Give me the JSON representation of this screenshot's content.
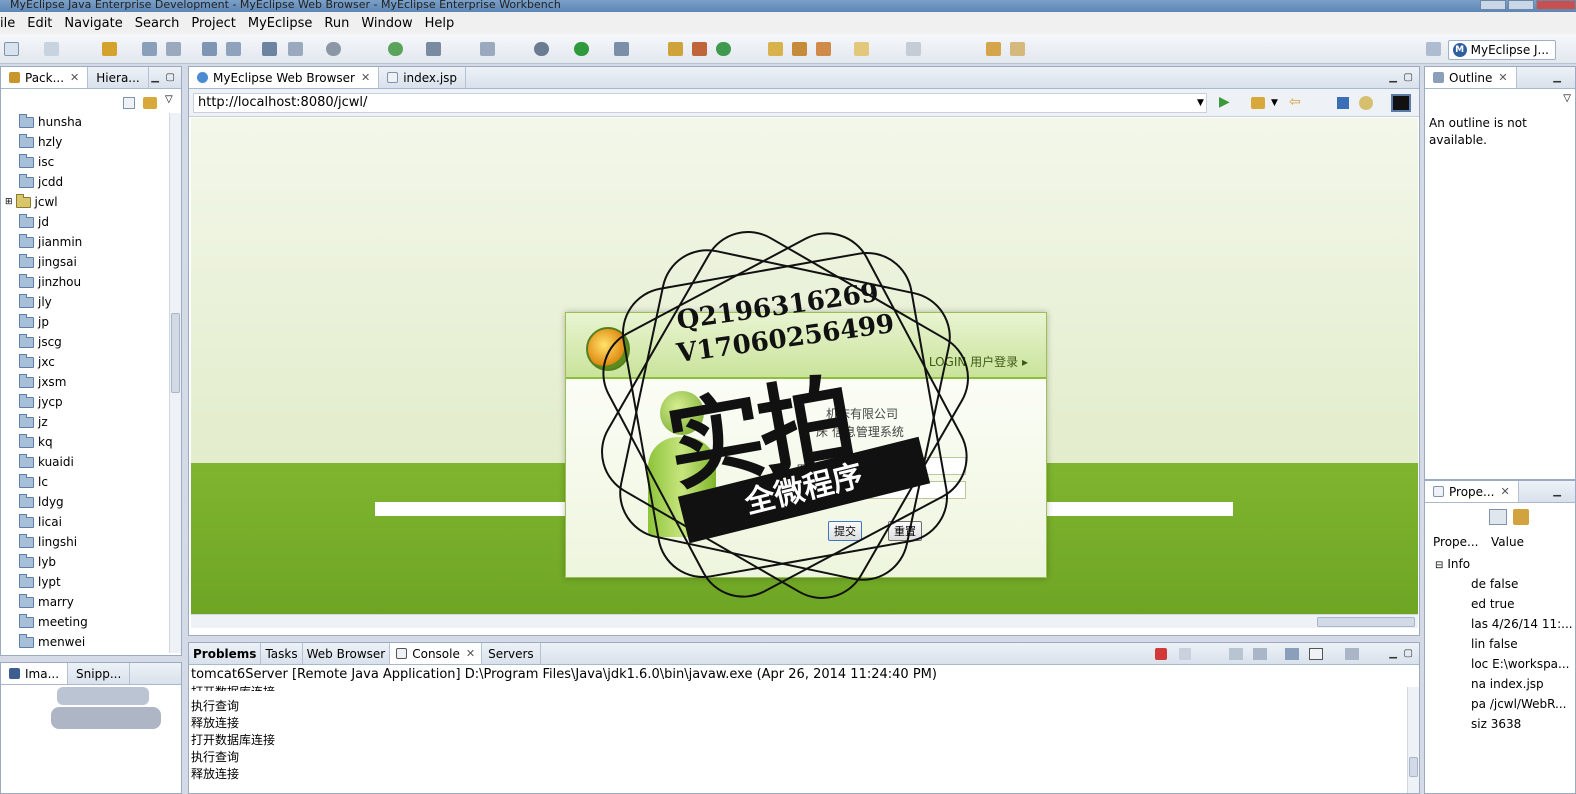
{
  "window": {
    "title": "MyEclipse Java Enterprise Development - MyEclipse Web Browser - MyEclipse Enterprise Workbench"
  },
  "menu": [
    "ile",
    "Edit",
    "Navigate",
    "Search",
    "Project",
    "MyEclipse",
    "Run",
    "Window",
    "Help"
  ],
  "perspective": {
    "label": "MyEclipse J...",
    "icon": "M"
  },
  "left_panel": {
    "tabs": [
      {
        "label": "Pack...",
        "close": "✕"
      },
      {
        "label": "Hiera..."
      }
    ],
    "items": [
      "hunsha",
      "hzly",
      "isc",
      "jcdd",
      "jcwl",
      "jd",
      "jianmin",
      "jingsai",
      "jinzhou",
      "jly",
      "jp",
      "jscg",
      "jxc",
      "jxsm",
      "jycp",
      "jz",
      "kq",
      "kuaidi",
      "lc",
      "ldyg",
      "licai",
      "lingshi",
      "lyb",
      "lypt",
      "marry",
      "meeting",
      "menwei"
    ]
  },
  "image_panel": {
    "tabs": [
      {
        "label": "Ima..."
      },
      {
        "label": "Snipp..."
      }
    ]
  },
  "editor": {
    "tabs": [
      {
        "label": "MyEclipse Web Browser",
        "close": "✕"
      },
      {
        "label": "index.jsp"
      }
    ],
    "url": "http://localhost:8080/jcwl/"
  },
  "login_page": {
    "title": "LOGIN 用户登录 ▸",
    "company_line1": "机床有限公司",
    "company_line2": "床 信息管理系统",
    "user_label": "用户:",
    "submit_label": "提交",
    "reset_label": "重置"
  },
  "watermark": {
    "qq": "Q2196316269",
    "wechat": "V17060256499",
    "big_text": "实拍",
    "ribbon": "全微程序",
    "star": "★"
  },
  "outline": {
    "tab": "Outline",
    "close": "✕",
    "message": "An outline is not available."
  },
  "properties": {
    "tab": "Prope...",
    "close": "✕",
    "col_property": "Prope...",
    "col_value": "Value",
    "group": "Info",
    "group_toggle": "⊟",
    "rows": [
      {
        "key": "de",
        "value": "false"
      },
      {
        "key": "ed",
        "value": "true"
      },
      {
        "key": "las",
        "value": "4/26/14 11:..."
      },
      {
        "key": "lin",
        "value": "false"
      },
      {
        "key": "loc",
        "value": "E:\\workspa..."
      },
      {
        "key": "na",
        "value": "index.jsp"
      },
      {
        "key": "pa",
        "value": "/jcwl/WebR..."
      },
      {
        "key": "siz",
        "value": "3638"
      }
    ]
  },
  "bottom_panel": {
    "tabs": [
      {
        "label": "Problems"
      },
      {
        "label": "Tasks"
      },
      {
        "label": "Web Browser"
      },
      {
        "label": "Console",
        "close": "✕"
      },
      {
        "label": "Servers"
      }
    ],
    "console_description": "tomcat6Server [Remote Java Application] D:\\Program Files\\Java\\jdk1.6.0\\bin\\javaw.exe (Apr 26, 2014 11:24:40 PM)",
    "console_lines": [
      "打开数据库连接",
      "执行查询",
      "释放连接",
      "打开数据库连接",
      "执行查询",
      "释放连接"
    ]
  },
  "colors": {
    "accent": "#7fb52f",
    "window_title": "#5d86b4",
    "panel_border": "#9aabc3"
  }
}
